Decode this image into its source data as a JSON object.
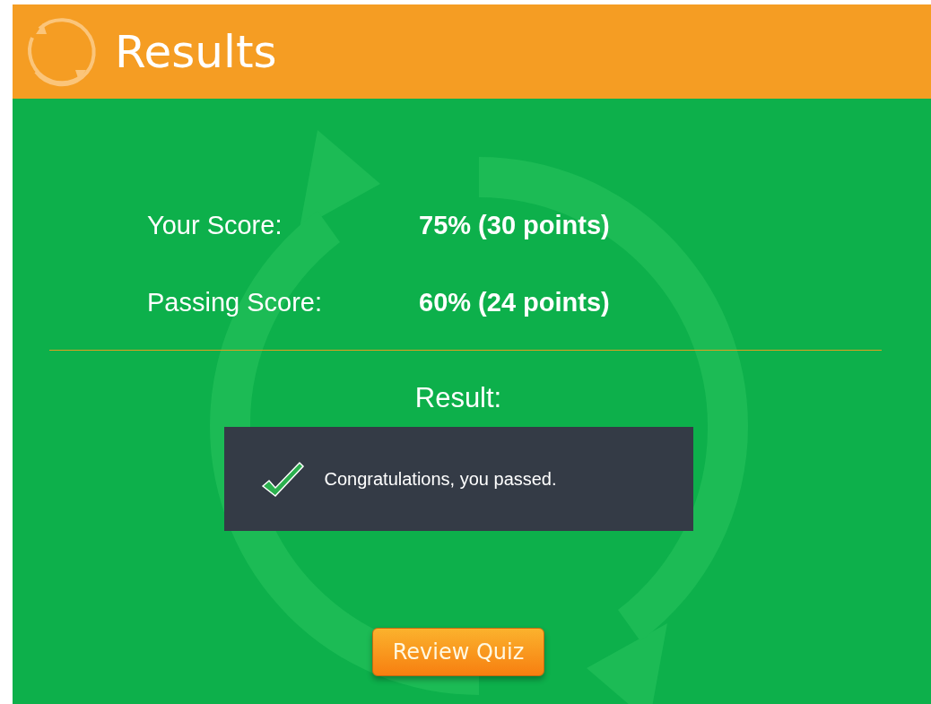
{
  "header": {
    "title": "Results"
  },
  "scores": [
    {
      "label": "Your Score:",
      "value": "75% (30 points)"
    },
    {
      "label": "Passing Score:",
      "value": "60% (24 points)"
    }
  ],
  "result": {
    "label": "Result:",
    "passed": true,
    "message": "Congratulations, you passed."
  },
  "buttons": [
    "Review Quiz"
  ]
}
